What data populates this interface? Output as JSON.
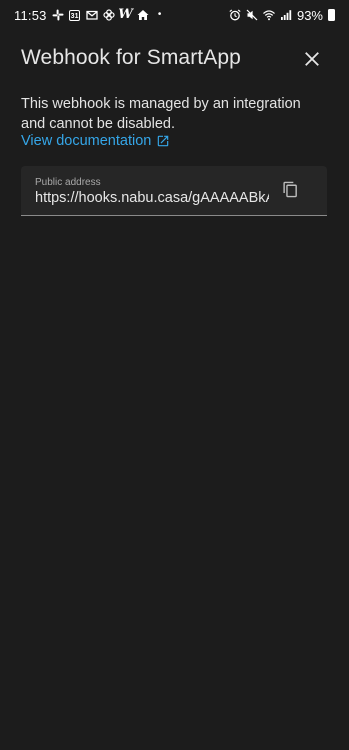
{
  "status_bar": {
    "time": "11:53",
    "calendar_day": "31",
    "w_glyph": "W",
    "dot": "•",
    "battery_percent": "93%"
  },
  "dialog": {
    "title": "Webhook for SmartApp",
    "description": "This webhook is managed by an integration and cannot be disabled.",
    "doc_link_label": "View documentation",
    "field": {
      "label": "Public address",
      "value": "https://hooks.nabu.casa/gAAAAABkANAk"
    }
  },
  "colors": {
    "background": "#1c1c1c",
    "link": "#35a6e8",
    "field_background": "#262626"
  },
  "icons": {
    "close": "close-icon",
    "open_in_new": "open-in-new-icon",
    "copy": "copy-icon"
  }
}
